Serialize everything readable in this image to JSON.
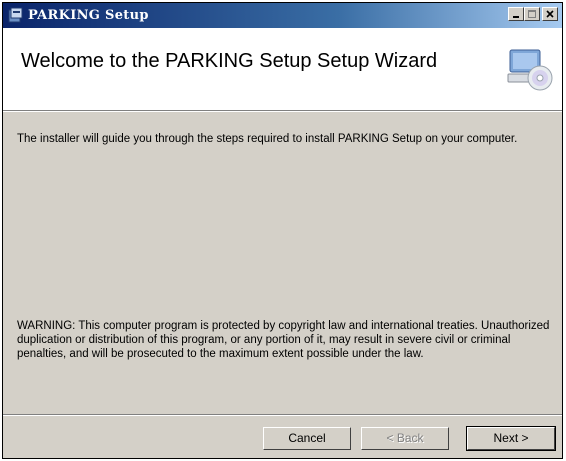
{
  "window": {
    "title": "PARKING Setup"
  },
  "header": {
    "title": "Welcome to the PARKING Setup Setup Wizard"
  },
  "body": {
    "intro": "The installer will guide you through the steps required to install PARKING Setup on your computer.",
    "warning": "WARNING: This computer program is protected by copyright law and international treaties. Unauthorized duplication or distribution of this program, or any portion of it, may result in severe civil or criminal penalties, and will be prosecuted to the maximum extent possible under the law."
  },
  "buttons": {
    "cancel": "Cancel",
    "back": "< Back",
    "next": "Next >"
  },
  "icons": {
    "app": "setup-package-icon",
    "header": "computer-cd-icon",
    "minimize": "minimize-icon",
    "maximize": "maximize-icon",
    "close": "close-icon"
  }
}
